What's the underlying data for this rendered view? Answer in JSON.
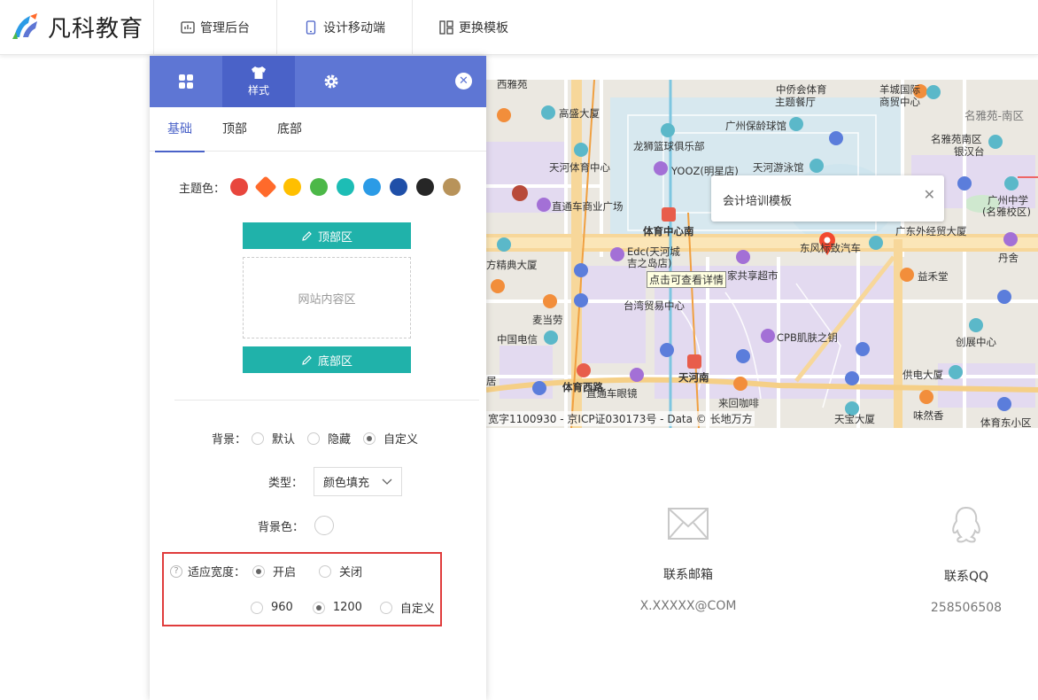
{
  "brand": {
    "name": "凡科教育"
  },
  "topnav": [
    {
      "label": "管理后台",
      "icon": "chart-icon"
    },
    {
      "label": "设计移动端",
      "icon": "mobile-icon"
    },
    {
      "label": "更换模板",
      "icon": "template-icon"
    }
  ],
  "panel": {
    "tabs": [
      {
        "label": "",
        "icon": "grid-icon"
      },
      {
        "label": "样式",
        "icon": "shirt-icon"
      },
      {
        "label": "",
        "icon": "gear-icon"
      }
    ],
    "subtabs": [
      "基础",
      "顶部",
      "底部"
    ],
    "theme": {
      "label": "主题色：",
      "colors": [
        "#e8463d",
        "#ff6a2b",
        "#ffbf00",
        "#4cb848",
        "#1dbdb5",
        "#2b9be6",
        "#1f4fa8",
        "#262626",
        "#b8935a"
      ]
    },
    "top_zone": "顶部区",
    "content_zone": "网站内容区",
    "bottom_zone": "底部区",
    "background": {
      "label": "背景：",
      "options": [
        "默认",
        "隐藏",
        "自定义"
      ],
      "selected": "自定义"
    },
    "type": {
      "label": "类型：",
      "value": "颜色填充"
    },
    "bg_color": {
      "label": "背景色："
    },
    "adapt_width": {
      "label": "适应宽度：",
      "options": [
        "开启",
        "关闭"
      ],
      "selected": "开启",
      "widths": [
        "960",
        "1200",
        "自定义"
      ],
      "selected_width": "1200"
    }
  },
  "map": {
    "popup_title": "会计培训模板",
    "tooltip": "点击可查看详情",
    "attribution": "宽字1100930 - 京ICP证030173号 - Data © 长地万方",
    "labels": [
      "西雅苑",
      "中侨会体育",
      "主题餐厅",
      "羊城国际",
      "商贸中心",
      "名雅苑-南区",
      "高盛大厦",
      "广州保龄球馆",
      "龙狮篮球俱乐部",
      "名雅苑南区",
      "银汉台",
      "天河体育中心",
      "YOOZ(明星店)",
      "天河游泳馆",
      "直通车商业广场",
      "体育中心南",
      "广东外经贸大厦",
      "广州中学",
      "(名雅校区)",
      "东风标致汽车",
      "Edc(天河城",
      "吉之岛店)",
      "家共享超市",
      "丹舍",
      "方精典大厦",
      "益禾堂",
      "麦当劳",
      "台湾贸易中心",
      "中国电信",
      "CPB肌肤之钥",
      "创展中心",
      "体育西路",
      "天河南",
      "直通车眼镜",
      "来回咖啡",
      "供电大厦",
      "居",
      "味然香",
      "天宝大厦",
      "体育东小区"
    ]
  },
  "contact": [
    {
      "label": "联系邮箱",
      "value": "X.XXXXX@COM",
      "icon": "mail-icon"
    },
    {
      "label": "联系QQ",
      "value": "258506508",
      "icon": "qq-icon"
    }
  ]
}
